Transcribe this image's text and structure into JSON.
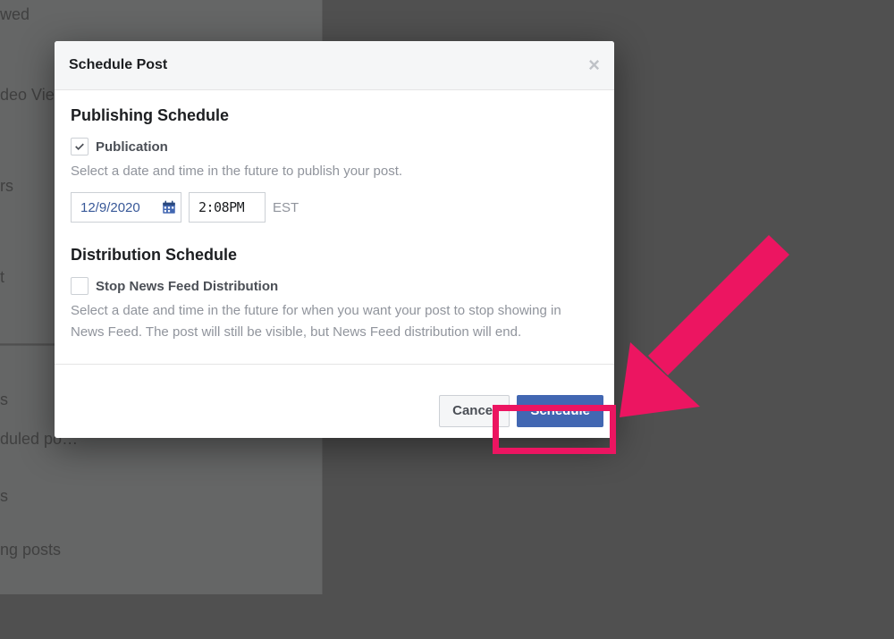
{
  "modal": {
    "title": "Schedule Post",
    "close_label": "×"
  },
  "sections": {
    "publishing": {
      "title": "Publishing Schedule",
      "checkbox_label": "Publication",
      "checked": true,
      "description": "Select a date and time in the future to publish your post.",
      "date_value": "12/9/2020",
      "time_value": "2:08PM",
      "timezone": "EST"
    },
    "distribution": {
      "title": "Distribution Schedule",
      "checkbox_label": "Stop News Feed Distribution",
      "checked": false,
      "description": "Select a date and time in the future for when you want your post to stop showing in News Feed. The post will still be visible, but News Feed distribution will end."
    }
  },
  "footer": {
    "cancel_label": "Cancel",
    "schedule_label": "Schedule"
  },
  "background": {
    "items_top": [
      "wed",
      "deo Vie…",
      "rs",
      "t"
    ],
    "items_bottom": [
      "s",
      "duled po…",
      "s",
      "ng posts"
    ]
  },
  "annotation": {
    "arrow_color": "#ec1561",
    "highlight_color": "#ec1561"
  }
}
